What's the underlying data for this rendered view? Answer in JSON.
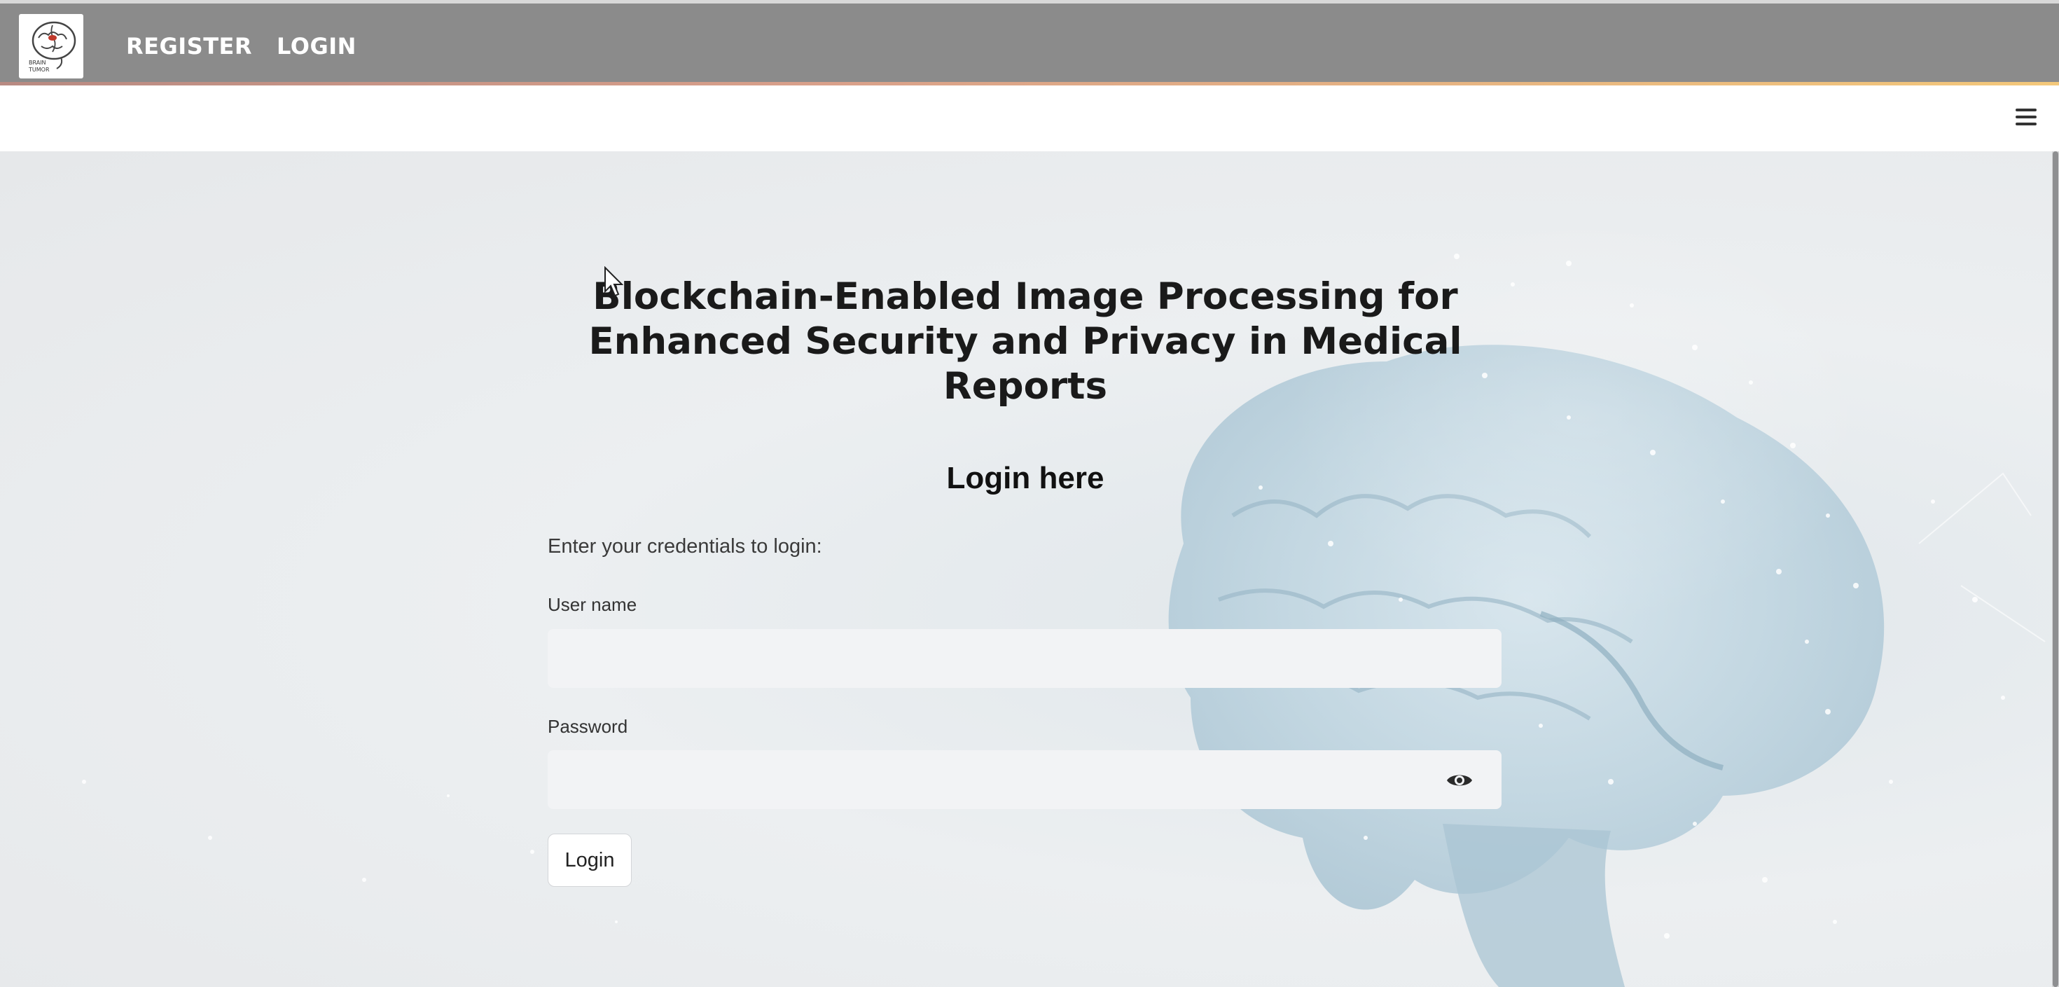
{
  "nav": {
    "register_label": "REGISTER",
    "login_label": "LOGIN",
    "logo_icon": "brain-tumor-logo-icon"
  },
  "appbar": {
    "menu_icon": "hamburger-menu-icon"
  },
  "main": {
    "title": "Blockchain-Enabled Image Processing for Enhanced Security and Privacy in Medical Reports",
    "subtitle": "Login here",
    "instructions": "Enter your credentials to login:",
    "username_label": "User name",
    "username_value": "",
    "password_label": "Password",
    "password_value": "",
    "password_toggle_icon": "eye-icon",
    "login_button_label": "Login"
  },
  "colors": {
    "nav_bg": "#8b8b8b",
    "nav_text": "#ffffff",
    "input_bg": "#f2f3f5",
    "title_text": "#1a1a1a"
  }
}
